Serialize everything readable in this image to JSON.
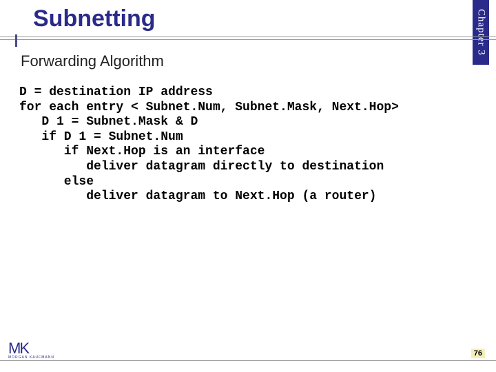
{
  "header": {
    "title": "Subnetting",
    "side_tab": "Chapter 3"
  },
  "content": {
    "subtitle": "Forwarding Algorithm",
    "code": "D = destination IP address\nfor each entry < Subnet.Num, Subnet.Mask, Next.Hop>\n   D 1 = Subnet.Mask & D\n   if D 1 = Subnet.Num\n      if Next.Hop is an interface\n         deliver datagram directly to destination\n      else\n         deliver datagram to Next.Hop (a router)"
  },
  "footer": {
    "logo_main": "MK",
    "logo_sub": "MORGAN KAUFMANN",
    "page_number": "76"
  }
}
